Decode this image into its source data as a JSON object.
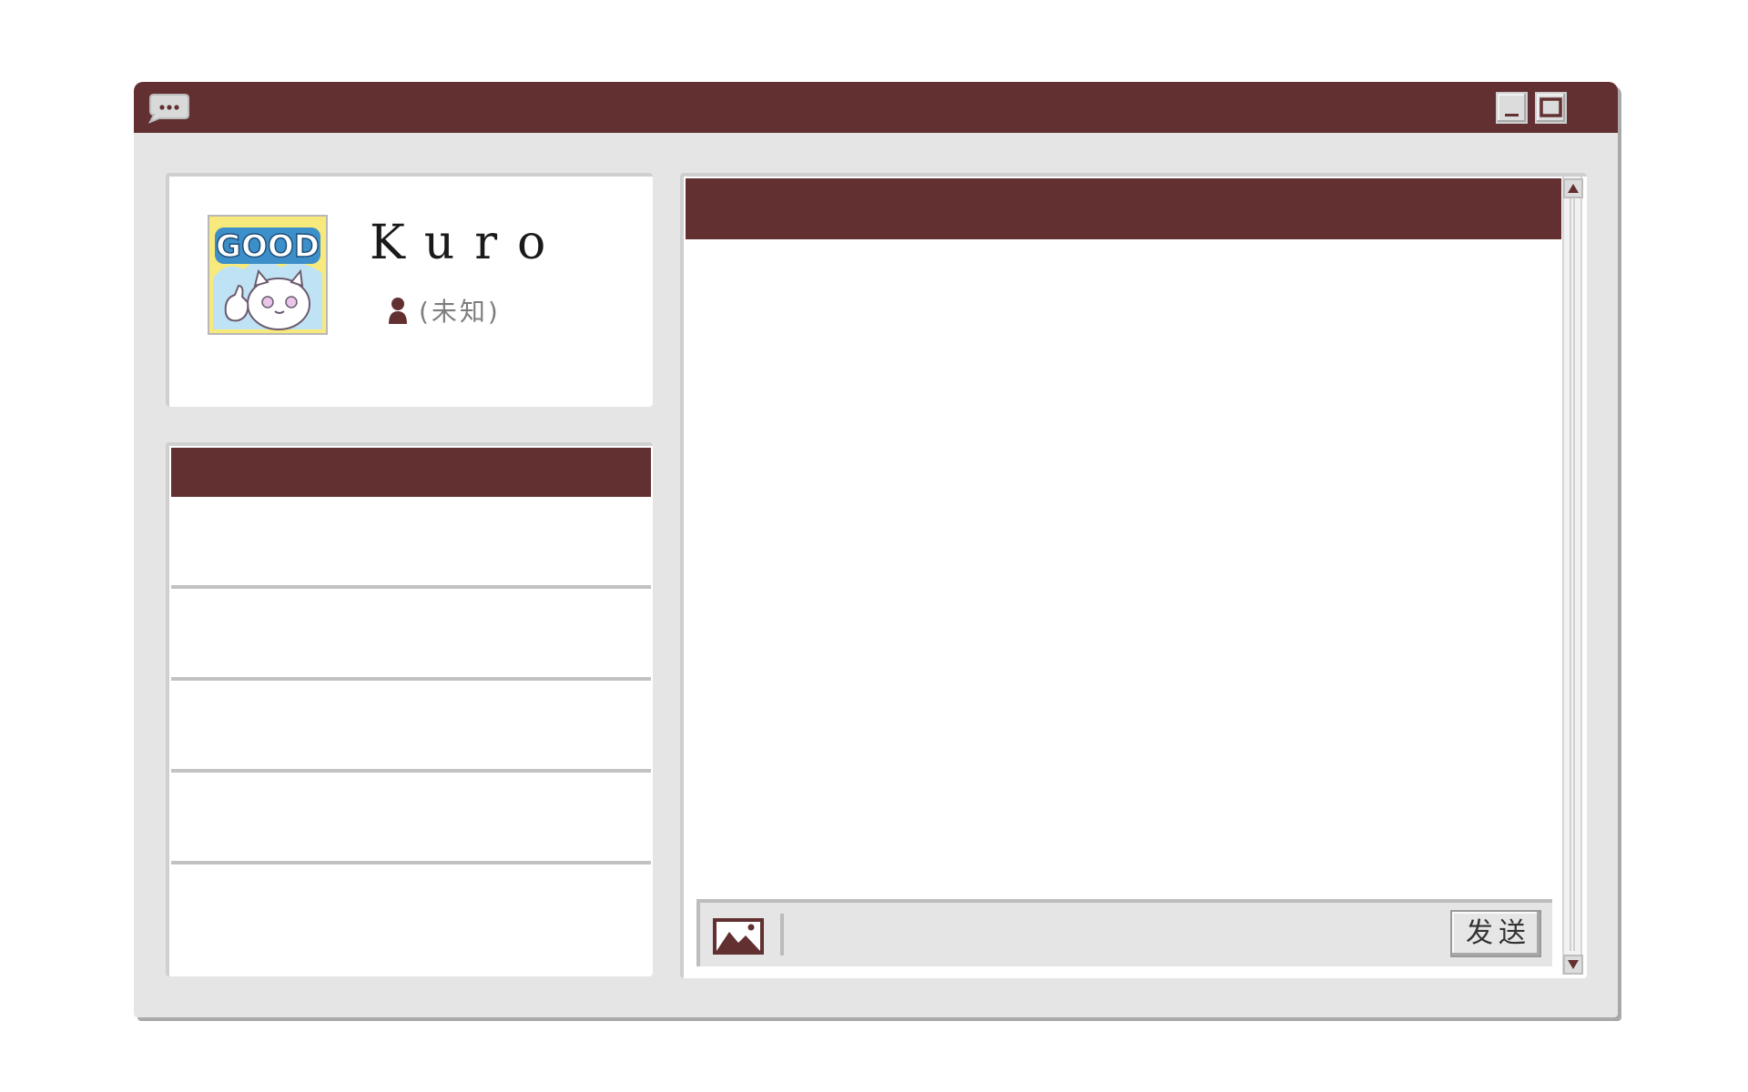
{
  "window": {
    "titlebar_color": "#623031",
    "app_icon": "chat-bubble-icon",
    "controls": {
      "minimize": "minimize-icon",
      "maximize": "maximize-icon"
    }
  },
  "profile": {
    "avatar_icon": "good-cat-sticker-avatar",
    "avatar_text": "GOOD",
    "username": "Kuro",
    "gender_icon": "person-icon",
    "gender": "(未知)"
  },
  "contact_list": {
    "header_color": "#623031",
    "items": [
      "",
      "",
      "",
      "",
      ""
    ]
  },
  "chat": {
    "header_color": "#623031",
    "image_button_icon": "image-icon",
    "message_input": {
      "value": "",
      "placeholder": ""
    },
    "send_label": "发送",
    "scroll_up_icon": "arrow-up-icon",
    "scroll_down_icon": "arrow-down-icon"
  }
}
